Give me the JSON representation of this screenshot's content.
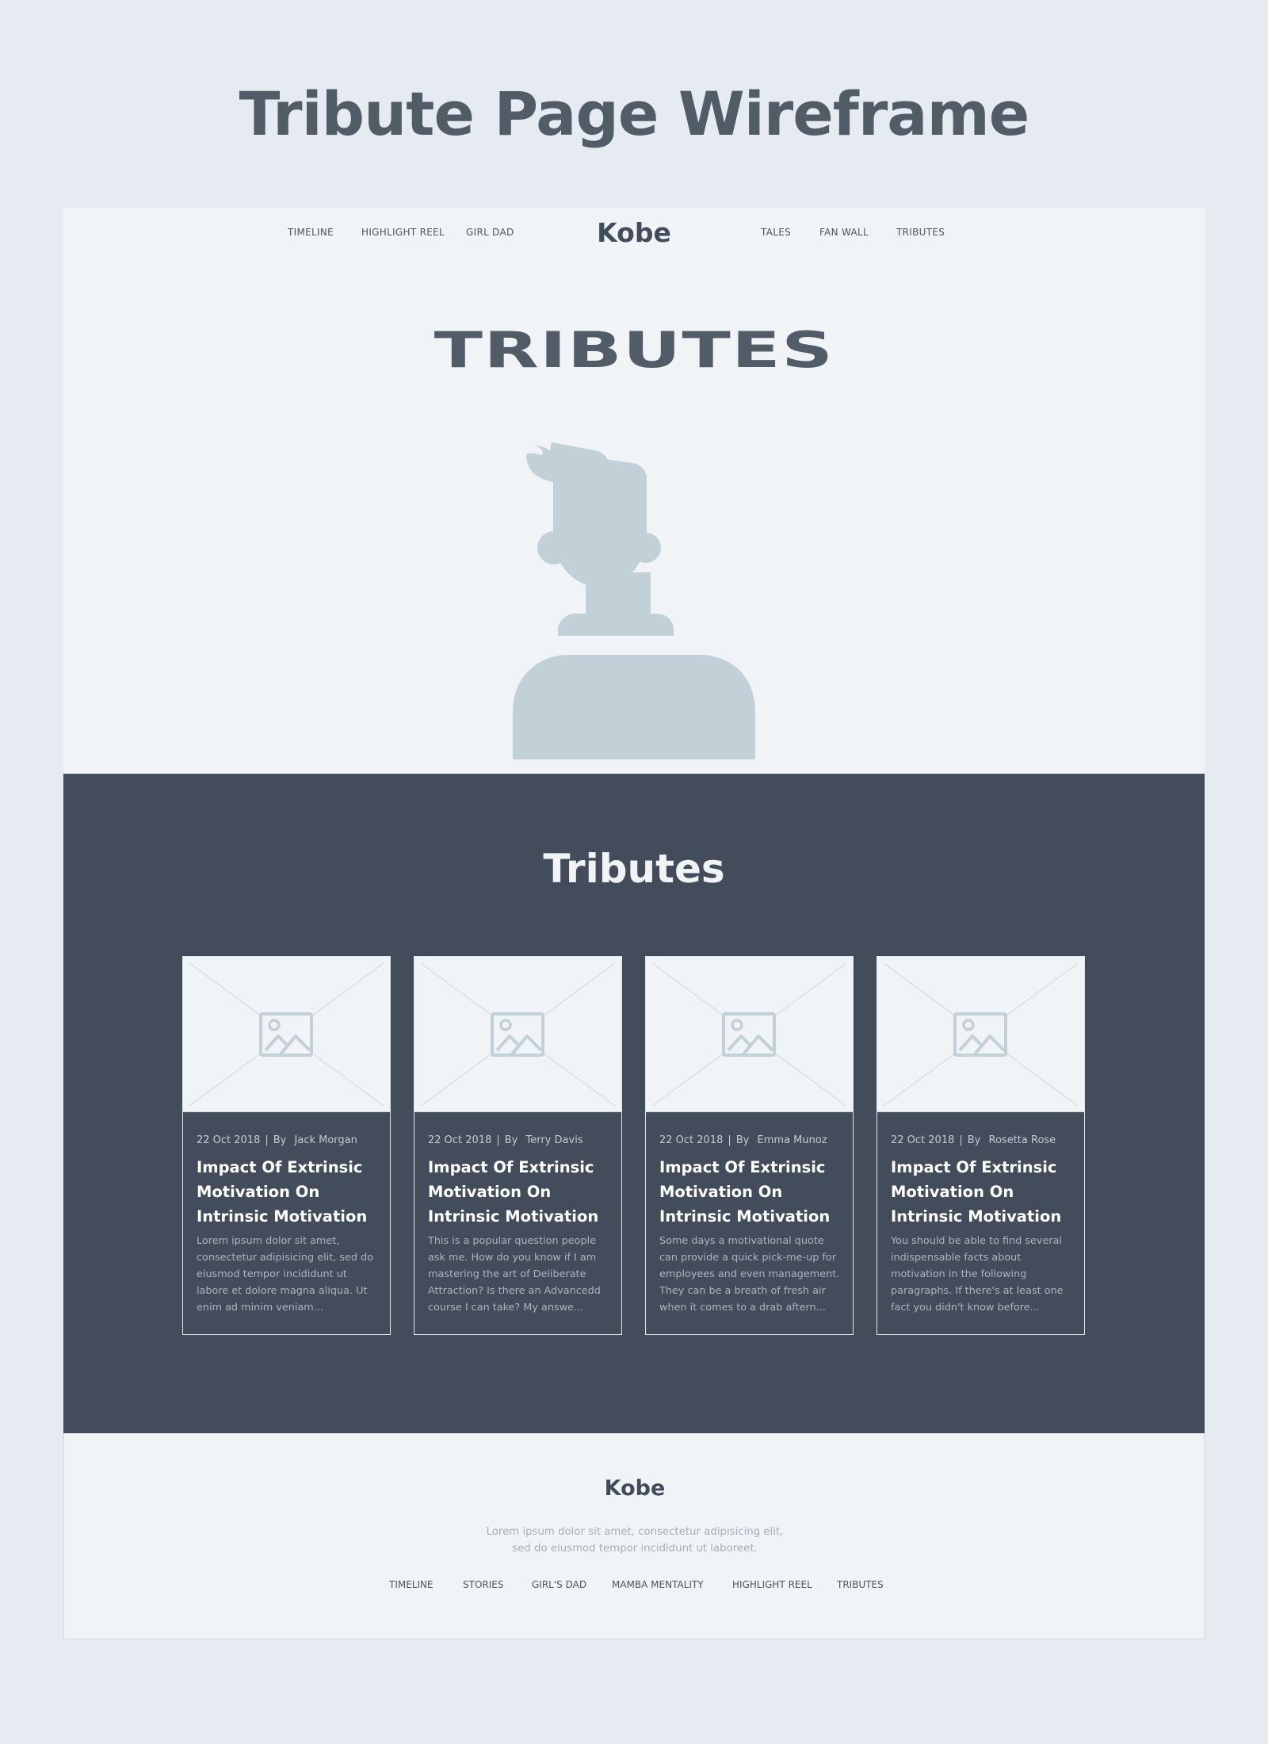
{
  "page_heading": "Tribute Page Wireframe",
  "colors": {
    "background": "#e6ebf2",
    "panel": "#f0f4f7",
    "band": "#434c5b",
    "avatar": "#c2d0d8",
    "heading": "#525c67"
  },
  "nav": {
    "brand": "Kobe",
    "left_links": [
      "Timeline",
      "Highlight Reel",
      "Girl Dad"
    ],
    "right_links": [
      "Tales",
      "Fan Wall",
      "Tributes"
    ]
  },
  "hero": {
    "title": "TRIBUTES",
    "avatar_icon": "person-silhouette-icon"
  },
  "tributes": {
    "title": "Tributes",
    "image_icon": "image-placeholder-icon",
    "cards": [
      {
        "date": "22 Oct 2018",
        "separator": "|",
        "by": "By",
        "author": "Jack Morgan",
        "title": "Impact Of Extrinsic Motivation On Intrinsic Motivation",
        "excerpt": "Lorem ipsum dolor sit amet, consectetur adipisicing elit, sed do eiusmod tempor incididunt ut labore et dolore magna aliqua. Ut enim ad minim veniam..."
      },
      {
        "date": "22 Oct 2018",
        "separator": "|",
        "by": "By",
        "author": "Terry Davis",
        "title": "Impact Of Extrinsic Motivation On Intrinsic Motivation",
        "excerpt": "This is a popular question people ask me. How do you know if I am mastering the art of Deliberate Attraction? Is there an Advancedd course I can take? My answe..."
      },
      {
        "date": "22 Oct 2018",
        "separator": "|",
        "by": "By",
        "author": "Emma Munoz",
        "title": "Impact Of Extrinsic Motivation On Intrinsic Motivation",
        "excerpt": "Some days a motivational quote can provide a quick pick-me-up for employees and even management. They can be a breath of fresh air when it comes to a drab aftern..."
      },
      {
        "date": "22 Oct 2018",
        "separator": "|",
        "by": "By",
        "author": "Rosetta Rose",
        "title": "Impact Of Extrinsic Motivation On Intrinsic Motivation",
        "excerpt": "You should be able to find several indispensable facts about motivation in the following paragraphs. If there's at least one fact you didn't know before..."
      }
    ]
  },
  "footer": {
    "brand": "Kobe",
    "text": "Lorem ipsum dolor sit amet, consectetur adipisicing elit, sed do eiusmod tempor incididunt ut laboreet.",
    "links": [
      "Timeline",
      "Stories",
      "Girl's Dad",
      "Mamba Mentality",
      "Highlight Reel",
      "Tributes"
    ]
  }
}
